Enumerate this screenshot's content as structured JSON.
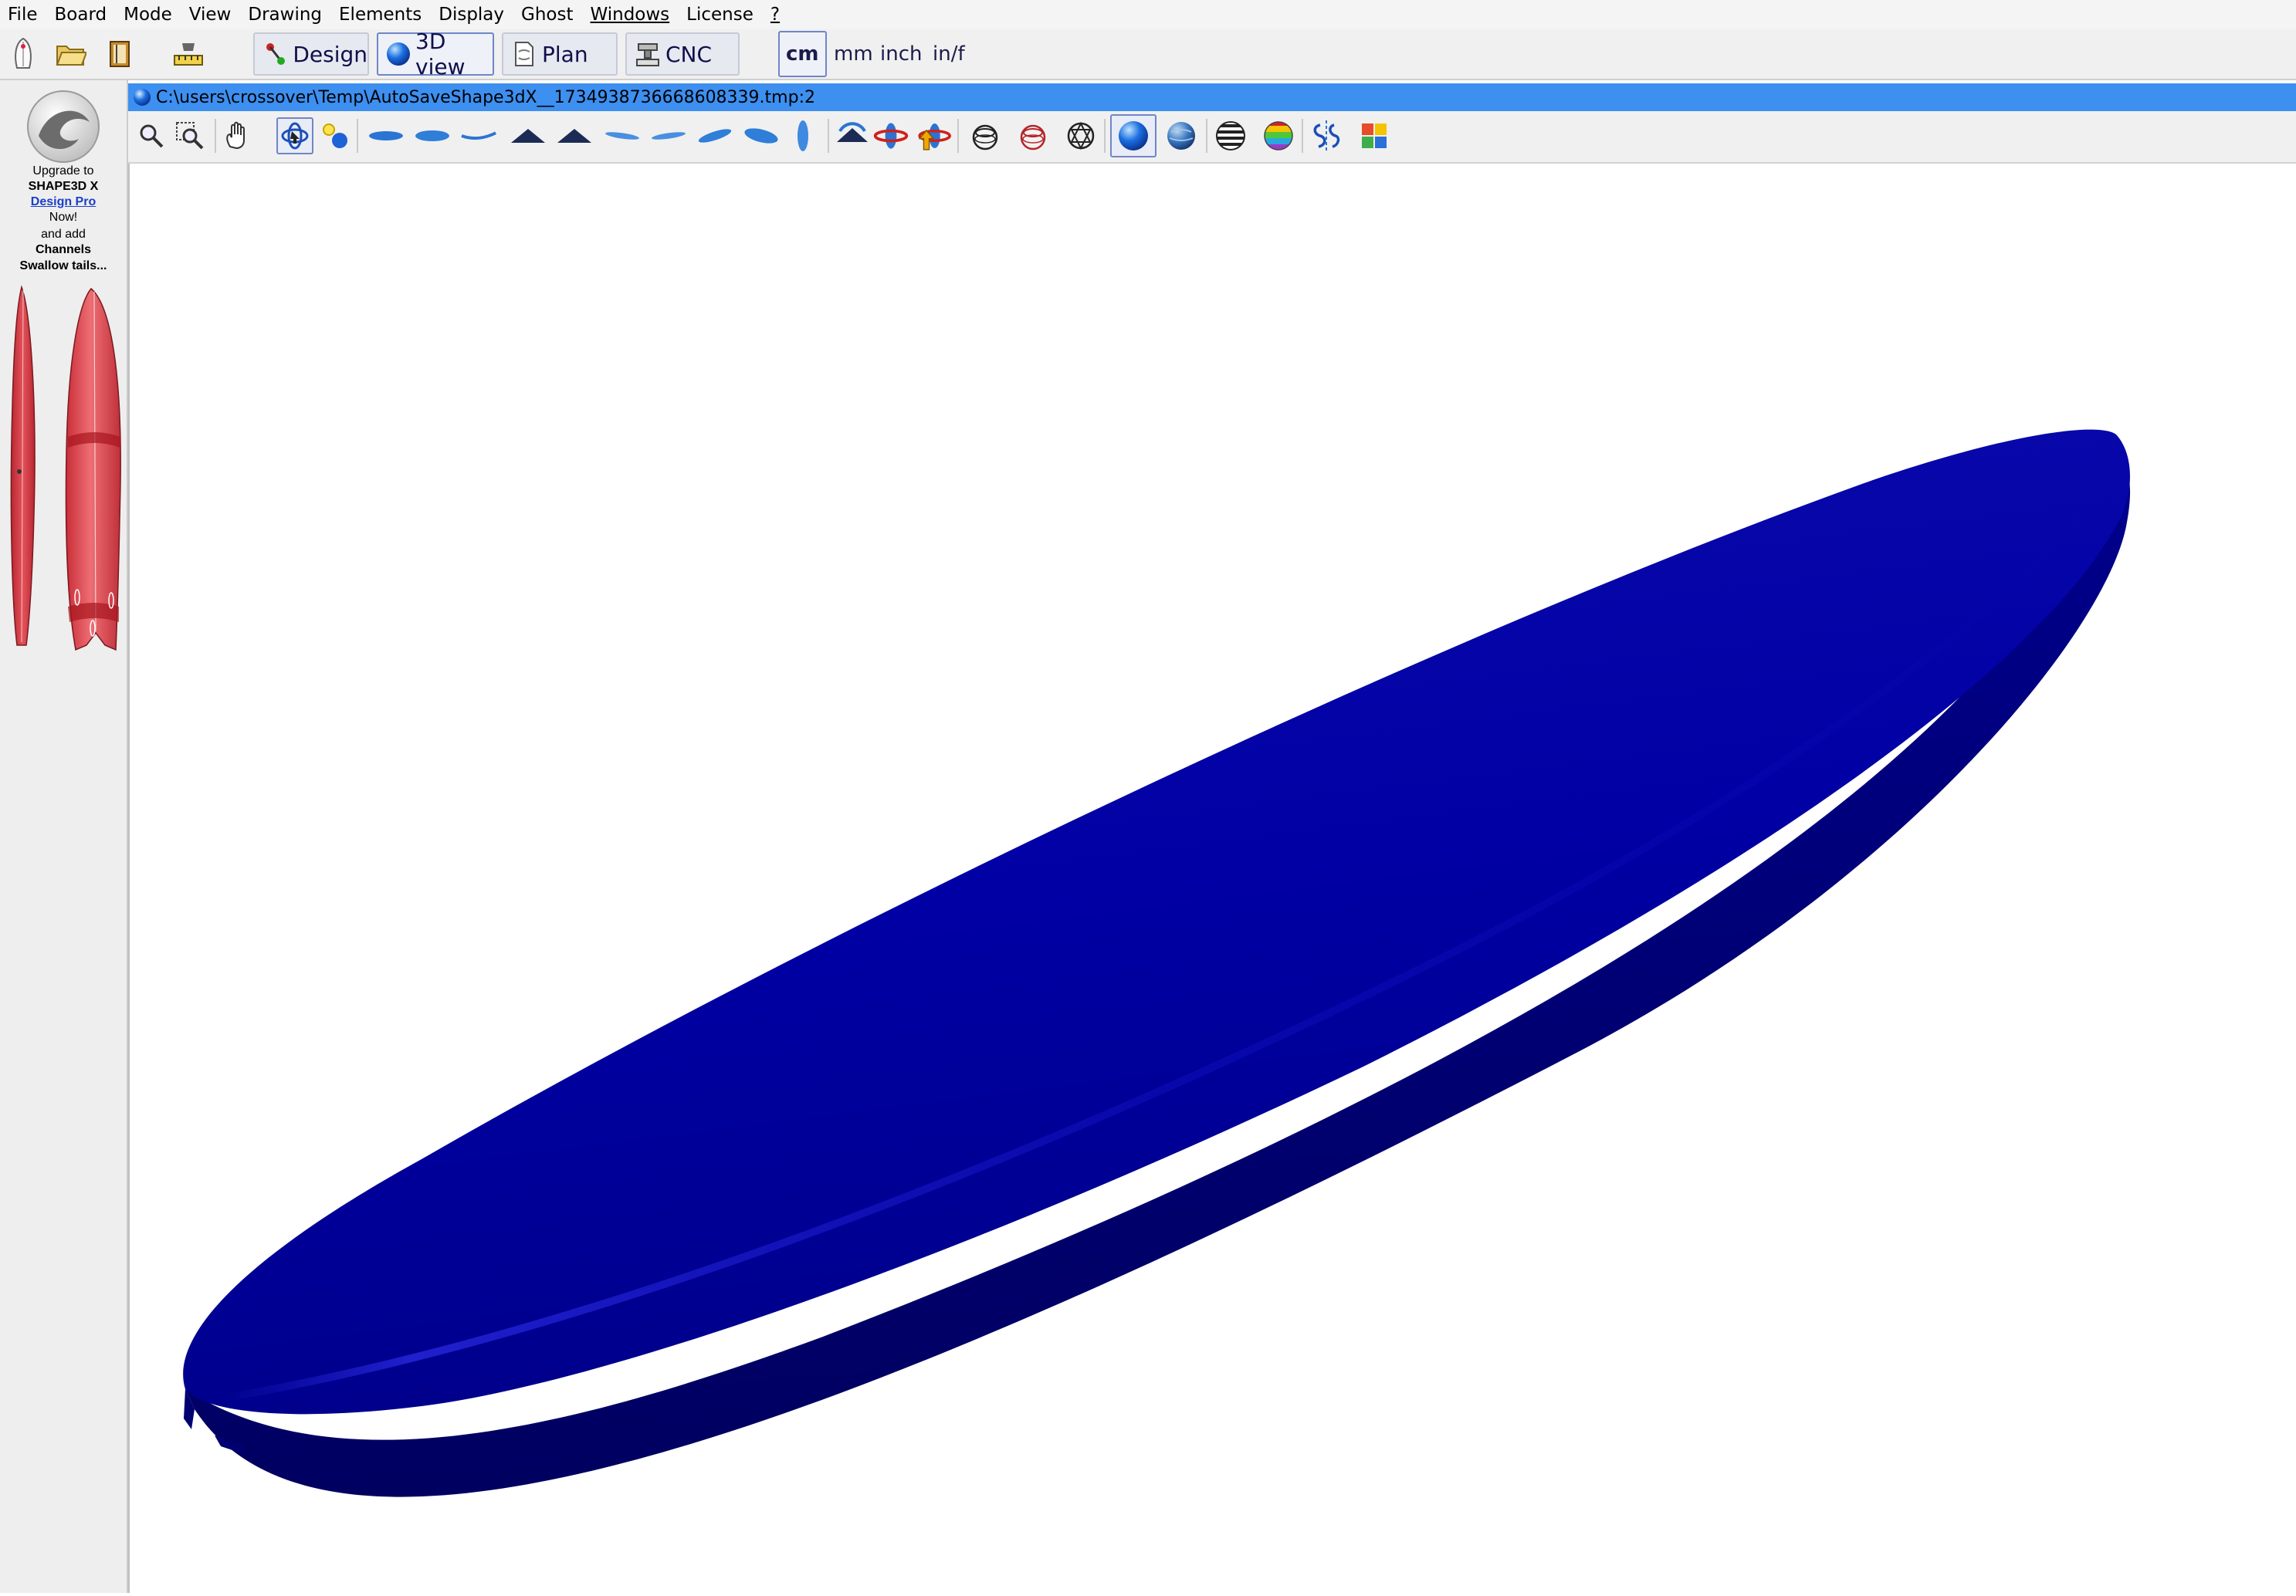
{
  "menu": {
    "items": [
      "File",
      "Board",
      "Mode",
      "View",
      "Drawing",
      "Elements",
      "Display",
      "Ghost",
      "Windows",
      "License",
      "?"
    ]
  },
  "toolbar": {
    "modes": [
      {
        "label": "Design",
        "icon": "design-icon",
        "active": false
      },
      {
        "label": "3D view",
        "icon": "sphere-icon",
        "active": true
      },
      {
        "label": "Plan",
        "icon": "plan-icon",
        "active": false
      },
      {
        "label": "CNC",
        "icon": "cnc-icon",
        "active": false
      }
    ],
    "units": [
      {
        "label": "cm",
        "active": true
      },
      {
        "label": "mm",
        "active": false
      },
      {
        "label": "inch",
        "active": false
      },
      {
        "label": "in/f",
        "active": false
      }
    ]
  },
  "ad": {
    "line1": "Upgrade to",
    "line2": "SHAPE3D X",
    "link": "Design Pro",
    "line3": "Now!",
    "line4": "and add",
    "line5": "Channels",
    "line6": "Swallow  tails..."
  },
  "document": {
    "title": "C:\\users\\crossover\\Temp\\AutoSaveShape3dX__1734938736668608339.tmp:2"
  },
  "colors": {
    "board": "#0000a0",
    "title_bar": "#3d8ff0",
    "ad_board": "#d9353e"
  }
}
